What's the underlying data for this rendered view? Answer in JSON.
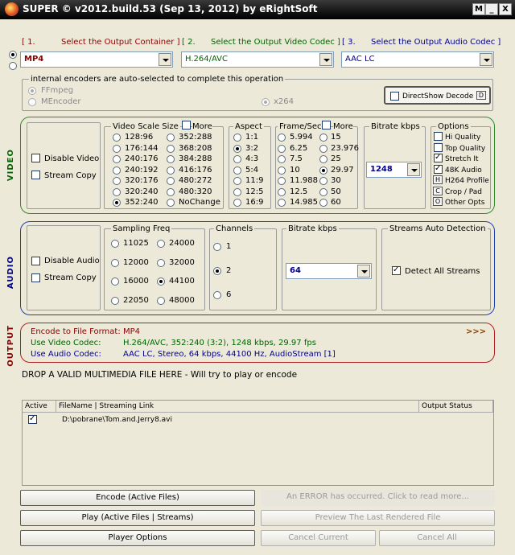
{
  "window": {
    "title": "SUPER © v2012.build.53 (Sep 13, 2012) by eRightSoft"
  },
  "titlebar_buttons": {
    "menu": "M",
    "minimize": "_",
    "close": "X"
  },
  "steps": {
    "s1_num": "[ 1.",
    "s1_label": "Select the Output Container ]",
    "s2_num": "[ 2.",
    "s2_label": "Select the Output Video Codec ]",
    "s3_num": "[ 3.",
    "s3_label": "Select the Output Audio Codec ]"
  },
  "selects": {
    "container": "MP4",
    "video_codec": "H.264/AVC",
    "audio_codec": "AAC LC"
  },
  "encoders": {
    "note": "internal encoders are auto-selected to complete this operation",
    "ffmpeg": "FFmpeg",
    "mencoder": "MEncoder",
    "x264": "x264",
    "directshow": "DirectShow Decode",
    "directshow_tag": "D"
  },
  "video": {
    "section_label": "VIDEO",
    "disable": "Disable Video",
    "stream_copy": "Stream Copy",
    "scale_title": "Video Scale Size",
    "more": "More",
    "scale_col1": [
      "128:96",
      "176:144",
      "240:176",
      "240:192",
      "320:176",
      "320:240",
      "352:240"
    ],
    "scale_col2": [
      "352:288",
      "368:208",
      "384:288",
      "416:176",
      "480:272",
      "480:320",
      "NoChange"
    ],
    "scale_selected": "352:240",
    "aspect_title": "Aspect",
    "aspects": [
      "1:1",
      "3:2",
      "4:3",
      "5:4",
      "11:9",
      "12:5",
      "16:9"
    ],
    "aspect_selected": "3:2",
    "fps_title": "Frame/Sec",
    "fps_more": "More",
    "fps_col1": [
      "5.994",
      "6.25",
      "7.5",
      "10",
      "11.988",
      "12.5",
      "14.985"
    ],
    "fps_col2": [
      "15",
      "23.976",
      "25",
      "29.97",
      "30",
      "50",
      "60"
    ],
    "fps_selected": "29.97",
    "bitrate_title": "Bitrate  kbps",
    "bitrate_value": "1248",
    "options_title": "Options",
    "options": [
      {
        "label": "Hi Quality",
        "checked": false,
        "kind": "check"
      },
      {
        "label": "Top Quality",
        "checked": false,
        "kind": "check"
      },
      {
        "label": "Stretch It",
        "checked": true,
        "kind": "check"
      },
      {
        "label": "48K Audio",
        "checked": true,
        "kind": "check"
      },
      {
        "label": "H264 Profile",
        "tag": "H",
        "kind": "tag"
      },
      {
        "label": "Crop / Pad",
        "tag": "C",
        "kind": "tag"
      },
      {
        "label": "Other Opts",
        "tag": "O",
        "kind": "tag"
      }
    ]
  },
  "audio": {
    "section_label": "AUDIO",
    "disable": "Disable Audio",
    "stream_copy": "Stream Copy",
    "sampling_title": "Sampling Freq",
    "sampling_col1": [
      "11025",
      "12000",
      "16000",
      "22050"
    ],
    "sampling_col2": [
      "24000",
      "32000",
      "44100",
      "48000"
    ],
    "sampling_selected": "44100",
    "channels_title": "Channels",
    "channels": [
      "1",
      "2",
      "6"
    ],
    "channels_selected": "2",
    "bitrate_title": "Bitrate  kbps",
    "bitrate_value": "64",
    "auto_title": "Streams Auto Detection",
    "detect_all": "Detect All Streams"
  },
  "output": {
    "section_label": "OUTPUT",
    "format_label": "Encode to File Format:",
    "format_value": "MP4",
    "more_arrows": ">>>",
    "video_label": "Use Video Codec:",
    "video_value": "H.264/AVC,  352:240 (3:2),  1248 kbps,  29.97 fps",
    "audio_label": "Use Audio Codec:",
    "audio_value": "AAC LC,  Stereo,  64 kbps,  44100 Hz,  AudioStream [1]"
  },
  "drop_text": "DROP A VALID MULTIMEDIA FILE HERE - Will try to play or encode",
  "file_list": {
    "headers": {
      "active": "Active",
      "filename": "FileName  |  Streaming Link",
      "status": "Output Status"
    },
    "rows": [
      {
        "active": true,
        "file": "D:\\pobrane\\Tom.and.Jerry8.avi",
        "status": ""
      }
    ]
  },
  "buttons": {
    "encode": "Encode (Active Files)",
    "play": "Play (Active Files | Streams)",
    "player_options": "Player Options",
    "error": "An ERROR has occurred. Click to read more...",
    "preview": "Preview The Last Rendered File",
    "cancel_current": "Cancel Current",
    "cancel_all": "Cancel All"
  },
  "colors": {
    "video_group": "#2e8b2e",
    "audio_group": "#1e3fb0",
    "output_group": "#b02020",
    "red_text": "#8b0000",
    "green_text": "#006400",
    "blue_text": "#00008b"
  }
}
